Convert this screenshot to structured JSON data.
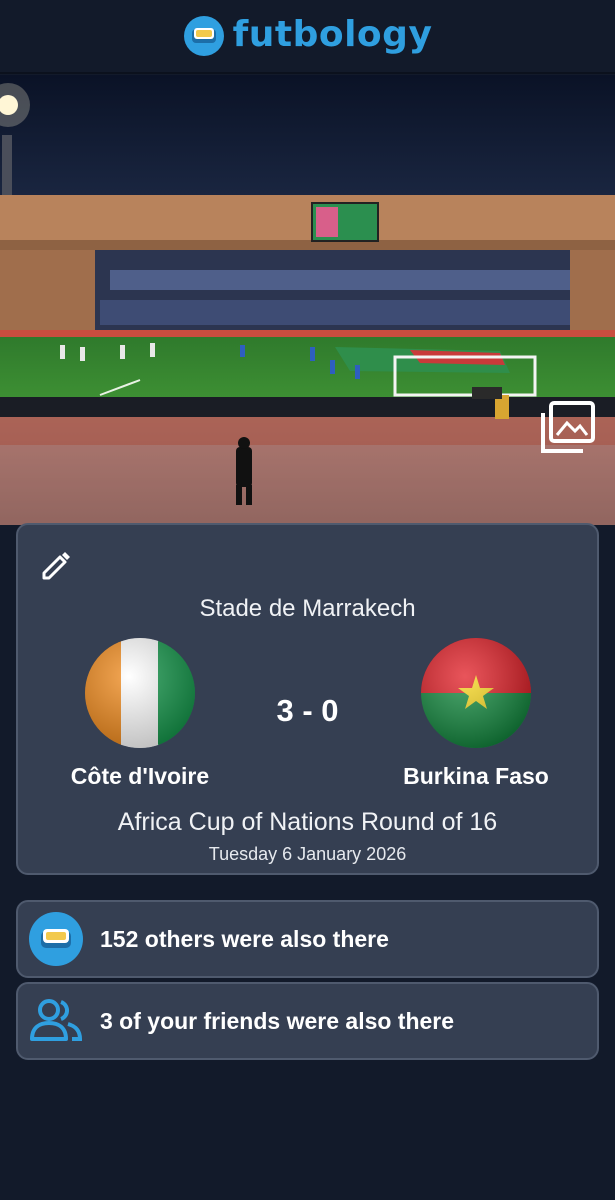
{
  "app": {
    "name": "futbology",
    "brand_color": "#2f9fe0"
  },
  "hero": {
    "gallery_icon": "photo-library-icon"
  },
  "match": {
    "edit_icon": "pencil-icon",
    "venue": "Stade de Marrakech",
    "home_team": {
      "name": "Côte d'Ivoire",
      "flag": "cote-divoire-flag"
    },
    "away_team": {
      "name": "Burkina Faso",
      "flag": "burkina-faso-flag"
    },
    "score": "3 - 0",
    "competition": "Africa Cup of Nations Round of 16",
    "date": "Tuesday 6 January 2026"
  },
  "attendance": {
    "others_text": "152 others were also there",
    "others_icon": "futbology-ticket-icon",
    "friends_text": "3 of your friends were also there",
    "friends_icon": "people-icon"
  },
  "colors": {
    "background": "#121a2a",
    "card": "#353f52",
    "card_border": "#4f5a6e"
  }
}
